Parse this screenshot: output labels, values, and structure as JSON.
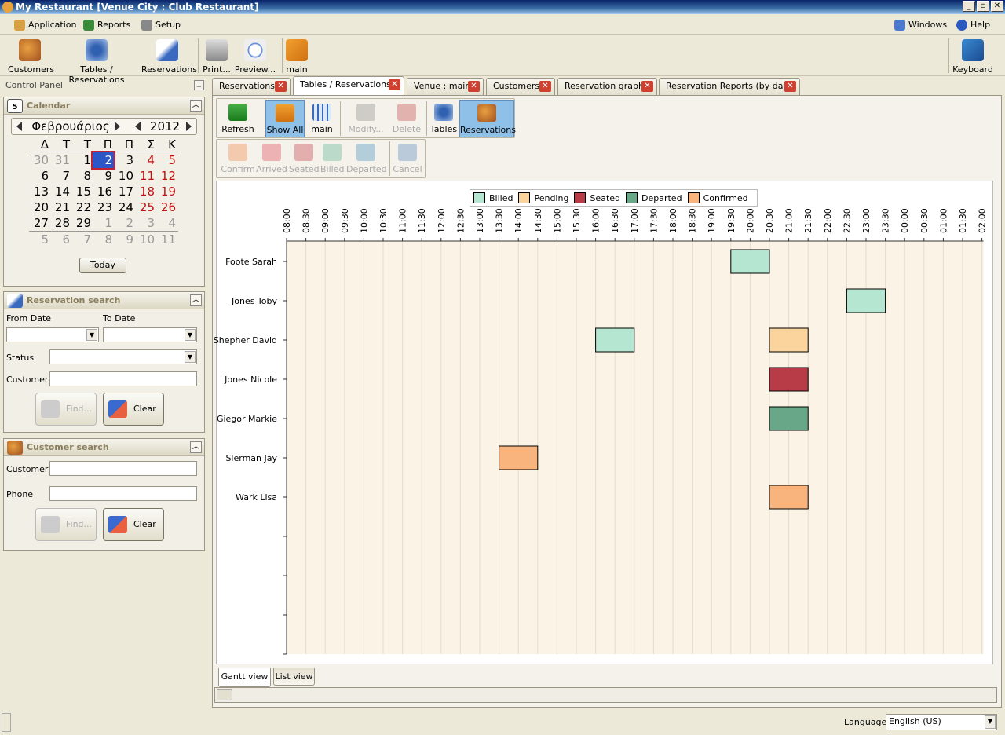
{
  "window": {
    "title": "My Restaurant [Venue City : Club Restaurant]"
  },
  "menu": [
    {
      "label": "Application"
    },
    {
      "label": "Reports"
    },
    {
      "label": "Setup"
    }
  ],
  "menu_right": [
    {
      "label": "Windows"
    },
    {
      "label": "Help"
    }
  ],
  "toolbar": {
    "customers": "Customers",
    "tables_reservations": "Tables / Reservations",
    "reservations": "Reservations",
    "print": "Print...",
    "preview": "Preview...",
    "main": "main",
    "keyboard": "Keyboard"
  },
  "control_panel": {
    "title": "Control Panel",
    "calendar": {
      "title": "Calendar",
      "month": "Φεβρουάριος",
      "year": "2012",
      "weekdays": [
        "Δ",
        "Τ",
        "Τ",
        "Π",
        "Π",
        "Σ",
        "Κ"
      ],
      "today_label": "Today",
      "icon_day": "5"
    },
    "reservation_search": {
      "title": "Reservation search",
      "from_date": "From Date",
      "to_date": "To Date",
      "status": "Status",
      "customer": "Customer",
      "find": "Find...",
      "clear": "Clear"
    },
    "customer_search": {
      "title": "Customer search",
      "customer": "Customer",
      "phone": "Phone",
      "find": "Find...",
      "clear": "Clear"
    }
  },
  "tabs": [
    {
      "label": "Reservations"
    },
    {
      "label": "Tables / Reservations"
    },
    {
      "label": "Venue : main"
    },
    {
      "label": "Customers"
    },
    {
      "label": "Reservation graph"
    },
    {
      "label": "Reservation Reports (by day)"
    }
  ],
  "gantt_toolbar": {
    "refresh": "Refresh",
    "show_all": "Show All",
    "main": "main",
    "modify": "Modify...",
    "delete": "Delete",
    "tables": "Tables",
    "reservations": "Reservations",
    "confirm": "Confirm",
    "arrived": "Arrived",
    "seated": "Seated",
    "billed": "Billed",
    "departed": "Departed",
    "cancel": "Cancel"
  },
  "legend": [
    {
      "label": "Billed",
      "color": "#b4e6d2"
    },
    {
      "label": "Pending",
      "color": "#fad49c"
    },
    {
      "label": "Seated",
      "color": "#b83c48"
    },
    {
      "label": "Departed",
      "color": "#68a888"
    },
    {
      "label": "Confirmed",
      "color": "#f9b47e"
    }
  ],
  "chart_data": {
    "type": "gantt",
    "time_ticks": [
      "08:00",
      "08:30",
      "09:00",
      "09:30",
      "10:00",
      "10:30",
      "11:00",
      "11:30",
      "12:00",
      "12:30",
      "13:00",
      "13:30",
      "14:00",
      "14:30",
      "15:00",
      "15:30",
      "16:00",
      "16:30",
      "17:00",
      "17:30",
      "18:00",
      "18:30",
      "19:00",
      "19:30",
      "20:00",
      "20:30",
      "21:00",
      "21:30",
      "22:00",
      "22:30",
      "23:00",
      "23:30",
      "00:00",
      "00:30",
      "01:00",
      "01:30",
      "02:00"
    ],
    "rows": [
      {
        "name": "Foote Sarah",
        "bars": [
          {
            "start": "19:30",
            "end": "20:30",
            "status": "Billed"
          }
        ]
      },
      {
        "name": "Jones Toby",
        "bars": [
          {
            "start": "22:30",
            "end": "23:30",
            "status": "Billed"
          }
        ]
      },
      {
        "name": "Shepher David",
        "bars": [
          {
            "start": "16:00",
            "end": "17:00",
            "status": "Billed"
          },
          {
            "start": "20:30",
            "end": "21:30",
            "status": "Pending"
          }
        ]
      },
      {
        "name": "Jones Nicole",
        "bars": [
          {
            "start": "20:30",
            "end": "21:30",
            "status": "Seated"
          }
        ]
      },
      {
        "name": "Giegor Markie",
        "bars": [
          {
            "start": "20:30",
            "end": "21:30",
            "status": "Departed"
          }
        ]
      },
      {
        "name": "Slerman Jay",
        "bars": [
          {
            "start": "13:30",
            "end": "14:30",
            "status": "Confirmed"
          }
        ]
      },
      {
        "name": "Wark Lisa",
        "bars": [
          {
            "start": "20:30",
            "end": "21:30",
            "status": "Confirmed"
          }
        ]
      }
    ]
  },
  "bottom_tabs": [
    {
      "label": "Gantt view"
    },
    {
      "label": "List view"
    }
  ],
  "status": {
    "language_label": "Language",
    "language_value": "English (US)"
  }
}
